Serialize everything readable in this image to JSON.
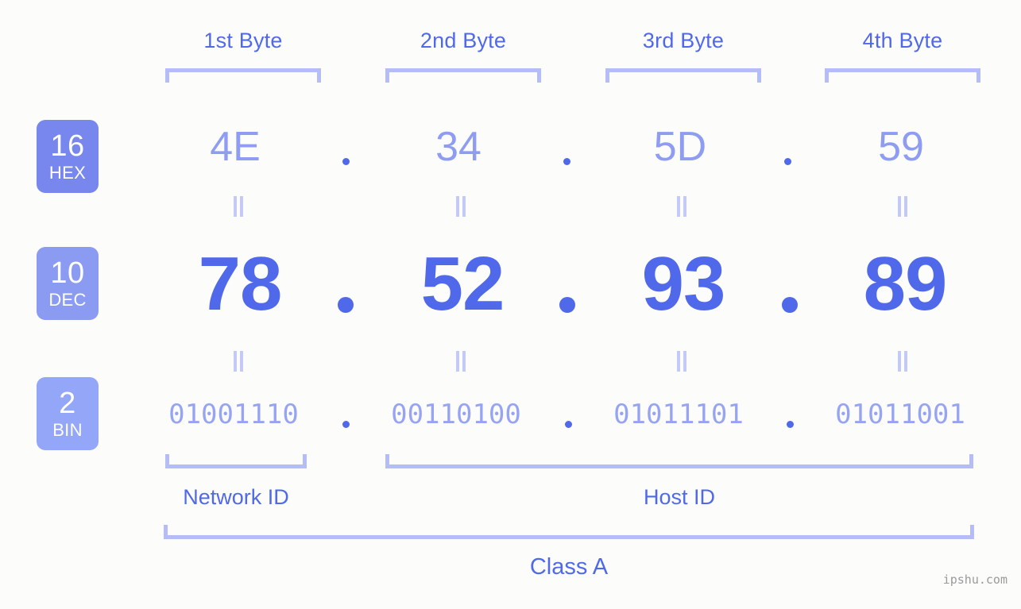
{
  "colors": {
    "background": "#fcfdfa",
    "accent_strong": "#5069ea",
    "accent_mid": "#8e9cf2",
    "accent_light": "#b4bdf7",
    "badge_hex": "#7787ee",
    "badge_dec": "#8c9bf2",
    "badge_bin": "#93a6f7",
    "watermark": "#9a9a9a"
  },
  "byte_headers": [
    {
      "label": "1st Byte"
    },
    {
      "label": "2nd Byte"
    },
    {
      "label": "3rd Byte"
    },
    {
      "label": "4th Byte"
    }
  ],
  "bases": [
    {
      "num": "16",
      "abbr": "HEX"
    },
    {
      "num": "10",
      "abbr": "DEC"
    },
    {
      "num": "2",
      "abbr": "BIN"
    }
  ],
  "rows": {
    "hex": {
      "values": [
        "4E",
        "34",
        "5D",
        "59"
      ],
      "separator": "."
    },
    "dec": {
      "values": [
        "78",
        "52",
        "93",
        "89"
      ],
      "separator": "."
    },
    "bin": {
      "values": [
        "01001110",
        "00110100",
        "01011101",
        "01011001"
      ],
      "separator": "."
    }
  },
  "equals_marker": "=",
  "sections": [
    {
      "label": "Network ID"
    },
    {
      "label": "Host ID"
    }
  ],
  "class": {
    "label": "Class A"
  },
  "watermark": {
    "text": "ipshu.com"
  }
}
